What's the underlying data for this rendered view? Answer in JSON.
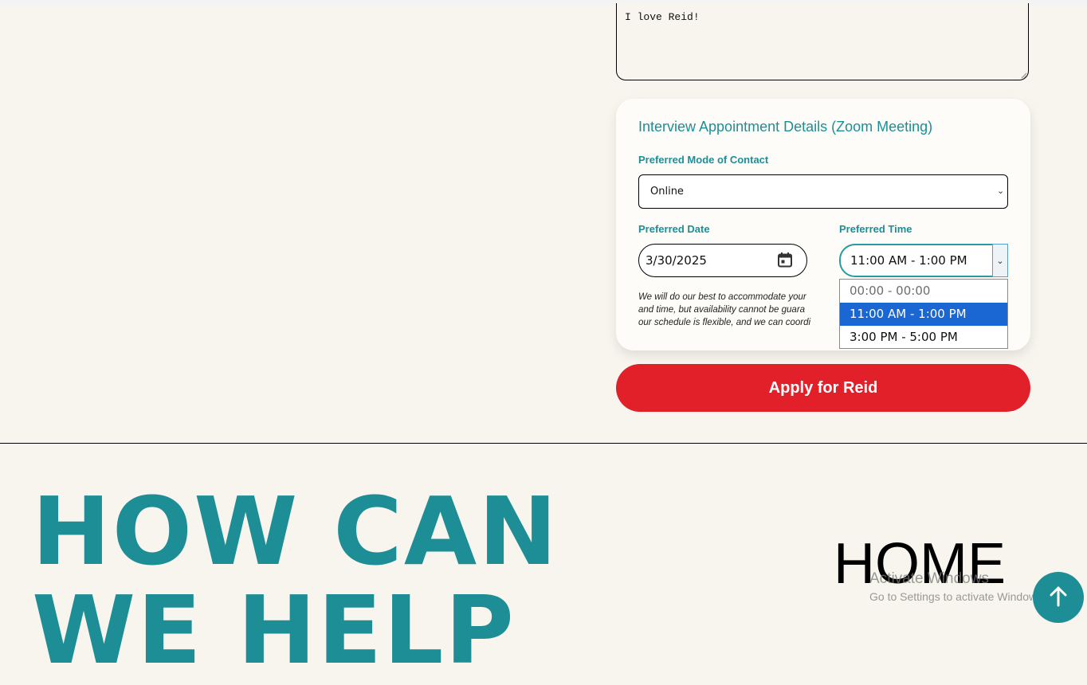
{
  "message": {
    "value": "I love Reid!"
  },
  "appointment": {
    "title": "Interview Appointment Details (Zoom Meeting)",
    "mode_label": "Preferred Mode of Contact",
    "mode_value": "Online",
    "date_label": "Preferred Date",
    "date_value": "3/30/2025",
    "time_label": "Preferred Time",
    "time_value": "11:00 AM - 1:00 PM",
    "time_options": [
      "00:00 - 00:00",
      "11:00 AM - 1:00 PM",
      "3:00 PM - 5:00 PM"
    ],
    "note_lines": [
      "We will do our best to accommodate your",
      "and time, but availability cannot be guara",
      "our schedule is flexible, and we can coordi"
    ]
  },
  "apply_button": "Apply for Reid",
  "footer": {
    "heading_line1": "HOW CAN",
    "heading_line2": "WE HELP",
    "home_link": "HOME"
  },
  "overlay": {
    "activate_title": "Activate Windows",
    "activate_sub": "Go to Settings to activate Windows."
  },
  "colors": {
    "accent": "#1e8e96",
    "button": "#e2202a",
    "background": "#f8f5ee",
    "selected_option": "#1a66d2"
  },
  "icons": [
    "calendar-icon",
    "chevron-down-icon",
    "arrow-up-icon"
  ]
}
